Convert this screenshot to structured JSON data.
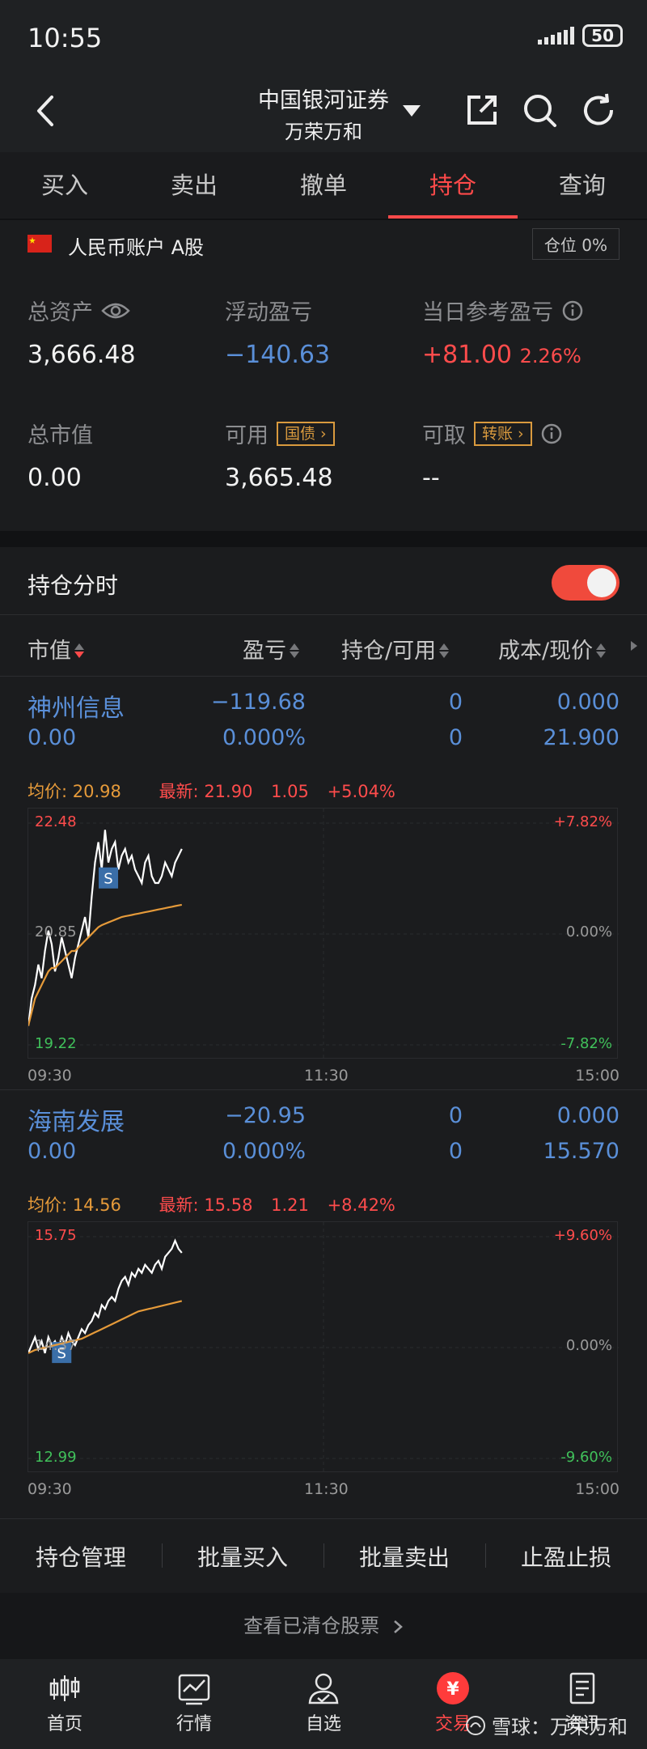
{
  "status_bar": {
    "time": "10:55",
    "battery": "50"
  },
  "header": {
    "broker": "中国银河证券",
    "account_name": "万荣万和"
  },
  "tabs": [
    {
      "label": "买入",
      "active": false
    },
    {
      "label": "卖出",
      "active": false
    },
    {
      "label": "撤单",
      "active": false
    },
    {
      "label": "持仓",
      "active": true
    },
    {
      "label": "查询",
      "active": false
    }
  ],
  "account": {
    "label": "人民币账户 A股",
    "position_ratio": "仓位 0%",
    "total_assets_label": "总资产",
    "total_assets": "3,666.48",
    "floating_pl_label": "浮动盈亏",
    "floating_pl": "−140.63",
    "daily_pl_label": "当日参考盈亏",
    "daily_pl": "+81.00",
    "daily_pl_pct": "2.26%",
    "market_value_label": "总市值",
    "market_value": "0.00",
    "available_label": "可用",
    "available_tag": "国债",
    "available": "3,665.48",
    "withdrawable_label": "可取",
    "withdrawable_tag": "转账",
    "withdrawable": "--"
  },
  "positions": {
    "intraday_label": "持仓分时",
    "intraday_enabled": true,
    "columns": [
      "市值",
      "盈亏",
      "持仓/可用",
      "成本/现价"
    ]
  },
  "stocks": [
    {
      "name": "神州信息",
      "market_value": "0.00",
      "pl": "−119.68",
      "pl_pct": "0.000%",
      "hold": "0",
      "avail": "0",
      "cost": "0.000",
      "price": "21.900",
      "avg_label": "均价: 20.98",
      "latest_label": "最新: 21.90",
      "change": "1.05",
      "change_pct": "+5.04%",
      "axis_high": "22.48",
      "axis_mid": "20.85",
      "axis_low": "19.22",
      "pct_high": "+7.82%",
      "pct_mid": "0.00%",
      "pct_low": "-7.82%",
      "sell_marker": "S"
    },
    {
      "name": "海南发展",
      "market_value": "0.00",
      "pl": "−20.95",
      "pl_pct": "0.000%",
      "hold": "0",
      "avail": "0",
      "cost": "0.000",
      "price": "15.570",
      "avg_label": "均价: 14.56",
      "latest_label": "最新: 15.58",
      "change": "1.21",
      "change_pct": "+8.42%",
      "axis_high": "15.75",
      "axis_mid": "14.37",
      "axis_low": "12.99",
      "pct_high": "+9.60%",
      "pct_mid": "0.00%",
      "pct_low": "-9.60%",
      "sell_marker": "S"
    }
  ],
  "time_axis": {
    "start": "09:30",
    "mid": "11:30",
    "end": "15:00"
  },
  "chart_data": [
    {
      "type": "line",
      "title": "",
      "ylim": [
        19.22,
        22.48
      ],
      "x_range": [
        "09:30",
        "15:00"
      ],
      "series": [
        {
          "name": "最新",
          "values": [
            19.5,
            19.9,
            20.1,
            20.4,
            20.2,
            20.6,
            20.9,
            20.7,
            20.3,
            20.5,
            20.8,
            20.6,
            20.4,
            20.2,
            20.5,
            20.7,
            20.9,
            21.1,
            20.8,
            21.4,
            21.9,
            22.2,
            21.8,
            22.38,
            21.9,
            22.1,
            22.2,
            21.8,
            22.0,
            22.1,
            21.9,
            22.0,
            21.8,
            21.7,
            21.6,
            21.9,
            22.0,
            21.7,
            21.6,
            21.6,
            21.7,
            21.9,
            21.8,
            21.7,
            21.9,
            22.0,
            22.1
          ]
        },
        {
          "name": "均价",
          "values": [
            19.5,
            19.7,
            19.9,
            20.0,
            20.1,
            20.2,
            20.3,
            20.35,
            20.35,
            20.4,
            20.45,
            20.5,
            20.55,
            20.6,
            20.6,
            20.65,
            20.7,
            20.75,
            20.8,
            20.85,
            20.9,
            20.95,
            20.98,
            21.0,
            21.02,
            21.04,
            21.06,
            21.08,
            21.1,
            21.11,
            21.12,
            21.13,
            21.14,
            21.15,
            21.16,
            21.17,
            21.18,
            21.19,
            21.2,
            21.21,
            21.22,
            21.23,
            21.24,
            21.25,
            21.26,
            21.27,
            21.28
          ]
        }
      ],
      "sell_marker_index": 24
    },
    {
      "type": "line",
      "title": "",
      "ylim": [
        12.99,
        15.75
      ],
      "x_range": [
        "09:30",
        "15:00"
      ],
      "series": [
        {
          "name": "最新",
          "values": [
            14.3,
            14.4,
            14.5,
            14.35,
            14.45,
            14.3,
            14.5,
            14.4,
            14.45,
            14.35,
            14.5,
            14.4,
            14.55,
            14.45,
            14.4,
            14.5,
            14.6,
            14.55,
            14.65,
            14.7,
            14.8,
            14.75,
            14.9,
            14.85,
            14.95,
            15.0,
            14.95,
            15.1,
            15.2,
            15.25,
            15.15,
            15.3,
            15.25,
            15.35,
            15.3,
            15.4,
            15.35,
            15.3,
            15.4,
            15.45,
            15.35,
            15.5,
            15.55,
            15.6,
            15.7,
            15.6,
            15.55
          ]
        },
        {
          "name": "均价",
          "values": [
            14.3,
            14.32,
            14.34,
            14.35,
            14.36,
            14.37,
            14.38,
            14.39,
            14.4,
            14.41,
            14.42,
            14.43,
            14.44,
            14.45,
            14.46,
            14.47,
            14.48,
            14.5,
            14.52,
            14.54,
            14.56,
            14.58,
            14.6,
            14.62,
            14.64,
            14.66,
            14.68,
            14.7,
            14.72,
            14.74,
            14.76,
            14.78,
            14.8,
            14.82,
            14.83,
            14.84,
            14.85,
            14.86,
            14.87,
            14.88,
            14.89,
            14.9,
            14.91,
            14.92,
            14.93,
            14.94,
            14.95
          ]
        }
      ],
      "sell_marker_index": 10
    }
  ],
  "colors": {
    "up": "#ff4c4c",
    "down": "#40c05a",
    "link": "#5a8fd8",
    "avg": "#e59a3a",
    "accent": "#ff4a4a"
  },
  "actions": [
    "持仓管理",
    "批量买入",
    "批量卖出",
    "止盈止损"
  ],
  "cleared_link": "查看已清仓股票",
  "bottom_nav": [
    {
      "label": "首页",
      "icon": "candlestick-icon"
    },
    {
      "label": "行情",
      "icon": "chart-icon"
    },
    {
      "label": "自选",
      "icon": "user-icon"
    },
    {
      "label": "交易",
      "icon": "yuan-icon",
      "active": true
    },
    {
      "label": "资讯",
      "icon": "document-icon"
    }
  ],
  "watermark": "雪球：万荣万和"
}
